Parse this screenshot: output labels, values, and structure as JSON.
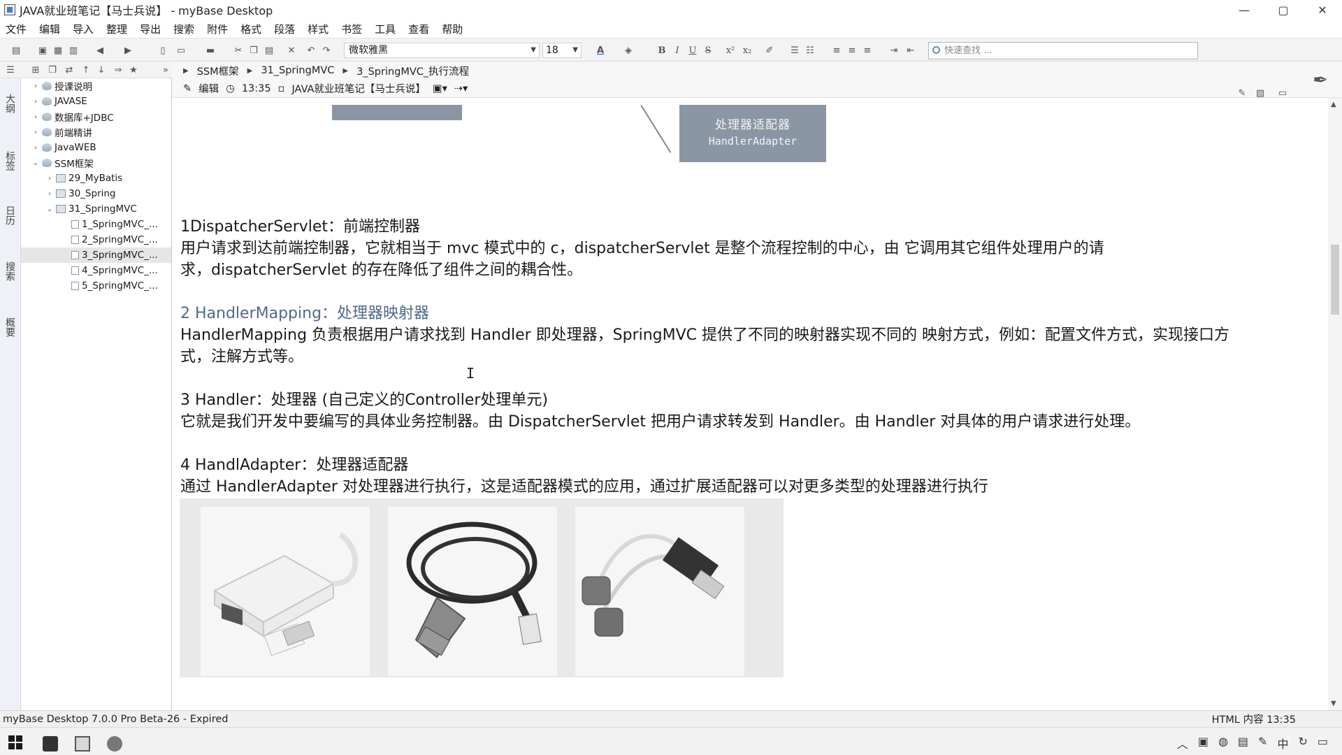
{
  "window": {
    "title": "JAVA就业班笔记【马士兵说】 - myBase Desktop",
    "controls": [
      "—",
      "▢",
      "✕"
    ]
  },
  "menubar": [
    "文件",
    "编辑",
    "导入",
    "整理",
    "导出",
    "搜索",
    "附件",
    "格式",
    "段落",
    "样式",
    "书签",
    "工具",
    "查看",
    "帮助"
  ],
  "toolbar": {
    "font_name": "微软雅黑",
    "font_size": "18",
    "search_placeholder": "快速查找 ..."
  },
  "side_tabs": [
    "大纲",
    "标签",
    "日历",
    "搜索",
    "概要"
  ],
  "tree": [
    {
      "label": "授课说明",
      "level": 0,
      "expanded": false,
      "icon": "folder"
    },
    {
      "label": "JAVASE",
      "level": 0,
      "expanded": false,
      "icon": "folder"
    },
    {
      "label": "数据库+JDBC",
      "level": 0,
      "expanded": false,
      "icon": "folder"
    },
    {
      "label": "前端精讲",
      "level": 0,
      "expanded": false,
      "icon": "folder"
    },
    {
      "label": "JavaWEB",
      "level": 0,
      "expanded": false,
      "icon": "folder"
    },
    {
      "label": "SSM框架",
      "level": 0,
      "expanded": true,
      "icon": "folder"
    },
    {
      "label": "29_MyBatis",
      "level": 1,
      "expanded": false,
      "icon": "book"
    },
    {
      "label": "30_Spring",
      "level": 1,
      "expanded": false,
      "icon": "book"
    },
    {
      "label": "31_SpringMVC",
      "level": 1,
      "expanded": true,
      "icon": "book"
    },
    {
      "label": "1_SpringMVC_...",
      "level": 2,
      "icon": "page"
    },
    {
      "label": "2_SpringMVC_...",
      "level": 2,
      "icon": "page"
    },
    {
      "label": "3_SpringMVC_...",
      "level": 2,
      "icon": "page",
      "selected": true
    },
    {
      "label": "4_SpringMVC_...",
      "level": 2,
      "icon": "page"
    },
    {
      "label": "5_SpringMVC_...",
      "level": 2,
      "icon": "page"
    }
  ],
  "breadcrumb": [
    "SSM框架",
    "31_SpringMVC",
    "3_SpringMVC_执行流程"
  ],
  "infobar": {
    "edit_label": "编辑",
    "time": "13:35",
    "notebook": "JAVA就业班笔记【马士兵说】"
  },
  "diagram": {
    "box_cn": "处理器适配器",
    "box_en": "HandlerAdapter"
  },
  "content": {
    "p1_title": "1DispatcherServlet：前端控制器",
    "p1_line1": "用户请求到达前端控制器，它就相当于 mvc 模式中的 c，dispatcherServlet 是整个流程控制的中心，由 它调用其它组件处理用户的请",
    "p1_line2": "求，dispatcherServlet 的存在降低了组件之间的耦合性。",
    "p2_title": "2 HandlerMapping：处理器映射器",
    "p2_line1": "HandlerMapping 负责根据用户请求找到 Handler 即处理器，SpringMVC 提供了不同的映射器实现不同的 映射方式，例如：配置文件方式，实现接口方",
    "p2_line2": "式，注解方式等。",
    "p3_title": "3 Handler：处理器 (自己定义的Controller处理单元)",
    "p3_line1": "它就是我们开发中要编写的具体业务控制器。由 DispatcherServlet 把用户请求转发到 Handler。由 Handler 对具体的用户请求进行处理。",
    "p4_title": "4 HandlAdapter：处理器适配器",
    "p4_line1": "通过 HandlerAdapter 对处理器进行执行，这是适配器模式的应用，通过扩展适配器可以对更多类型的处理器进行执行"
  },
  "images": [
    "usb-ethernet-adapter",
    "usb-serial-cable",
    "usb-ps2-adapter"
  ],
  "statusbar": {
    "left": "myBase Desktop 7.0.0 Pro Beta-26 - Expired",
    "right": "HTML 内容  13:35"
  },
  "colors": {
    "heading_blue": "#4f6a8a",
    "diagram_box": "#8a96a3"
  }
}
